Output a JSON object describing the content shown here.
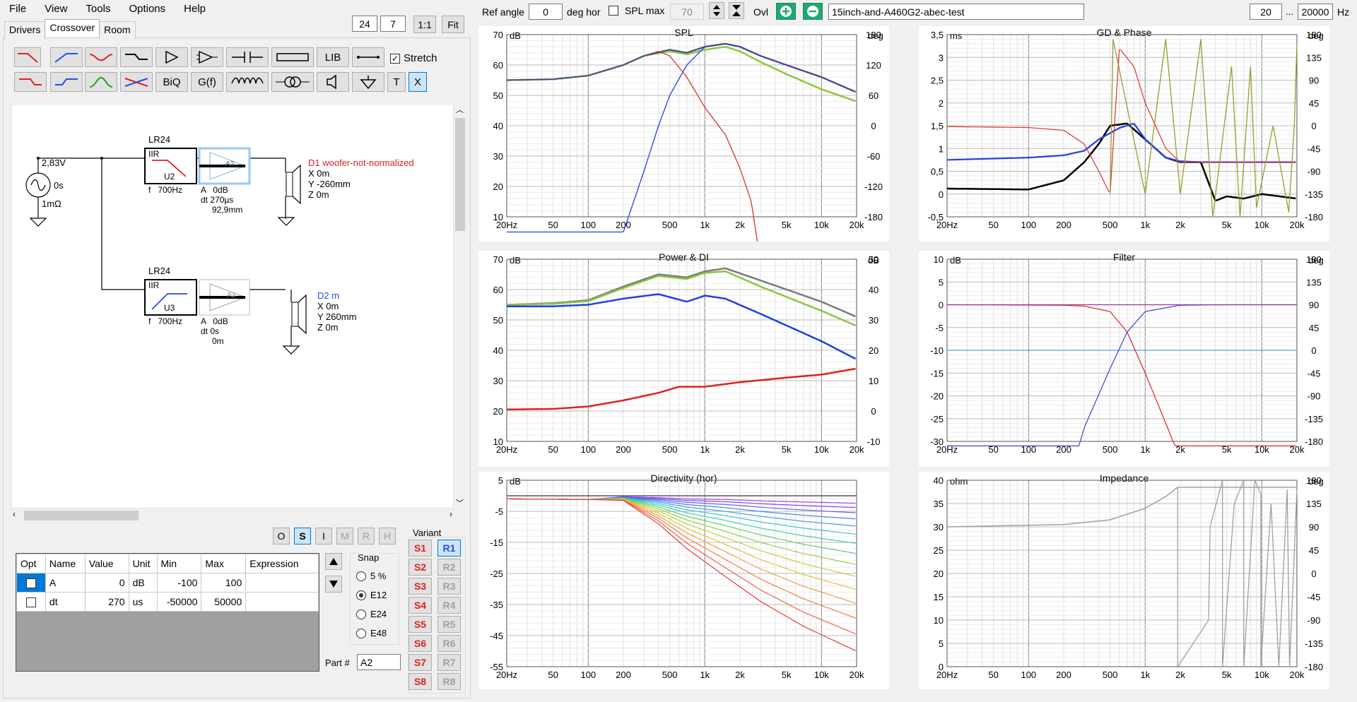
{
  "menu": [
    "File",
    "View",
    "Tools",
    "Options",
    "Help"
  ],
  "tabs": [
    "Drivers",
    "Crossover",
    "Room"
  ],
  "zoom": {
    "a": "24",
    "b": "7",
    "ratio": "1:1",
    "fit": "Fit"
  },
  "toolbar": {
    "lib": "LIB",
    "biq": "BiQ",
    "gf": "G(f)",
    "t": "T",
    "x": "X",
    "stretch": "Stretch"
  },
  "schematic": {
    "source": {
      "voltage": "2,83V",
      "delay": "0s",
      "res": "1mΩ"
    },
    "filter1": {
      "type": "LR24",
      "kind": "IIR",
      "ref": "U2",
      "f": "f   700Hz",
      "a": "A   0dB",
      "dt": "dt 270µs",
      "dist": "92,9mm"
    },
    "filter2": {
      "type": "LR24",
      "kind": "IIR",
      "ref": "U3",
      "f": "f   700Hz",
      "a": "A   0dB",
      "dt": "dt 0s",
      "dist": "0m"
    },
    "d1": {
      "name": "D1 woofer-not-normalized",
      "x": "X 0m",
      "y": "Y -260mm",
      "z": "Z 0m"
    },
    "d2": {
      "name": "D2 m",
      "x": "X 0m",
      "y": "Y 260mm",
      "z": "Z 0m"
    },
    "amp": "A2",
    "amp2": "A3"
  },
  "modes": [
    "O",
    "S",
    "I",
    "M",
    "R",
    "H"
  ],
  "params": {
    "headers": [
      "Opt",
      "Name",
      "Value",
      "Unit",
      "Min",
      "Max",
      "Expression"
    ],
    "rows": [
      [
        "",
        "A",
        "0",
        "dB",
        "-100",
        "100",
        ""
      ],
      [
        "",
        "dt",
        "270",
        "us",
        "-50000",
        "50000",
        ""
      ]
    ]
  },
  "snap": {
    "label": "Snap",
    "options": [
      "5 %",
      "E12",
      "E24",
      "E48"
    ],
    "selected": "E12"
  },
  "variant": {
    "label": "Variant",
    "s": [
      "S1",
      "S2",
      "S3",
      "S4",
      "S5",
      "S6",
      "S7",
      "S8"
    ],
    "r": [
      "R1",
      "R2",
      "R3",
      "R4",
      "R5",
      "R6",
      "R7",
      "R8"
    ]
  },
  "part": {
    "label": "Part #",
    "value": "A2"
  },
  "top": {
    "ref_angle_label": "Ref angle",
    "ref_angle": "0",
    "deg_hor": "deg hor",
    "spl_max_label": "SPL max",
    "spl_max": "70",
    "ovl": "Ovl",
    "project": "15inch-and-A460G2-abec-test",
    "f_lo": "20",
    "dots": "...",
    "f_hi": "20000",
    "hz": "Hz"
  },
  "charts": {
    "spl": {
      "title": "SPL",
      "left_unit": "dB",
      "right_unit": "deg"
    },
    "gd": {
      "title": "GD & Phase",
      "left_unit": "ms",
      "right_unit": "deg"
    },
    "power": {
      "title": "Power & DI",
      "left_unit": "dB",
      "right_unit": "dB"
    },
    "filter": {
      "title": "Filter",
      "left_unit": "dB",
      "right_unit": "deg"
    },
    "dir": {
      "title": "Directivity (hor)",
      "left_unit": "dB",
      "right_unit": ""
    },
    "imp": {
      "title": "Impedance",
      "left_unit": "ohm",
      "right_unit": "deg"
    }
  },
  "chart_data": [
    {
      "type": "line",
      "title": "SPL",
      "xlabel": "Hz",
      "ylabel": "dB",
      "x": [
        20,
        50,
        100,
        200,
        300,
        500,
        700,
        1000,
        1500,
        2000,
        3000,
        5000,
        10000,
        20000
      ],
      "series": [
        {
          "values": [
            55,
            55.3,
            56.5,
            60,
            63,
            65,
            64,
            66,
            67,
            66,
            63,
            60,
            56,
            51
          ]
        },
        {
          "values": [
            55,
            55.3,
            56.5,
            60,
            63,
            64.5,
            63.5,
            65,
            66,
            64.5,
            61,
            57,
            52,
            48
          ]
        }
      ],
      "ylim": [
        10,
        70
      ],
      "y2lim": [
        -180,
        180
      ],
      "xlim": [
        20,
        20000
      ]
    },
    {
      "type": "line",
      "title": "Power & DI",
      "xlabel": "Hz",
      "ylabel": "dB",
      "x": [
        20,
        50,
        100,
        200,
        400,
        700,
        1000,
        1500,
        3000,
        10000,
        20000
      ],
      "series": [
        {
          "values": [
            55,
            55.5,
            56.5,
            61,
            65,
            64,
            66,
            67,
            63,
            56,
            51
          ]
        },
        {
          "values": [
            54.5,
            54.5,
            55,
            57,
            58.5,
            56,
            58,
            57,
            52,
            43,
            37
          ]
        }
      ],
      "ylim": [
        10,
        70
      ],
      "y2lim": [
        -10,
        50
      ]
    },
    {
      "type": "line",
      "title": "Filter",
      "ylabel": "dB",
      "ylim": [
        -30,
        10
      ],
      "y2lim": [
        -180,
        180
      ]
    },
    {
      "type": "line",
      "title": "GD & Phase",
      "ylabel": "ms",
      "ylim": [
        -0.5,
        3.5
      ],
      "y2lim": [
        -180,
        180
      ]
    },
    {
      "type": "line",
      "title": "Directivity (hor)",
      "ylabel": "dB",
      "ylim": [
        -55,
        5
      ]
    },
    {
      "type": "line",
      "title": "Impedance",
      "ylabel": "ohm",
      "ylim": [
        0,
        40
      ],
      "y2lim": [
        -180,
        180
      ]
    }
  ],
  "axes": {
    "x": [
      "20Hz",
      "50",
      "100",
      "200",
      "500",
      "1k",
      "2k",
      "5k",
      "10k",
      "20k"
    ],
    "spl_l": [
      "70",
      "60",
      "50",
      "40",
      "30",
      "20",
      "10"
    ],
    "spl_r": [
      "180",
      "120",
      "60",
      "0",
      "-60",
      "-120",
      "-180"
    ],
    "gd_l": [
      "3,5",
      "3",
      "2,5",
      "2",
      "1,5",
      "1",
      "0,5",
      "0",
      "-0,5"
    ],
    "gd_r": [
      "180",
      "135",
      "90",
      "45",
      "0",
      "-45",
      "-90",
      "-135",
      "-180"
    ],
    "pw_l": [
      "70",
      "60",
      "50",
      "40",
      "30",
      "20",
      "10"
    ],
    "pw_r": [
      "50",
      "40",
      "30",
      "20",
      "10",
      "0",
      "-10"
    ],
    "fl_l": [
      "10",
      "5",
      "0",
      "-5",
      "-10",
      "-15",
      "-20",
      "-25",
      "-30"
    ],
    "fl_r": [
      "180",
      "135",
      "90",
      "45",
      "0",
      "-45",
      "-90",
      "-135",
      "-180"
    ],
    "dir_l": [
      "5",
      "-5",
      "-15",
      "-25",
      "-35",
      "-45",
      "-55"
    ],
    "imp_l": [
      "40",
      "35",
      "30",
      "25",
      "20",
      "15",
      "10",
      "5",
      "0"
    ],
    "imp_r": [
      "180",
      "135",
      "90",
      "45",
      "0",
      "-45",
      "-90",
      "-135",
      "-180"
    ]
  }
}
